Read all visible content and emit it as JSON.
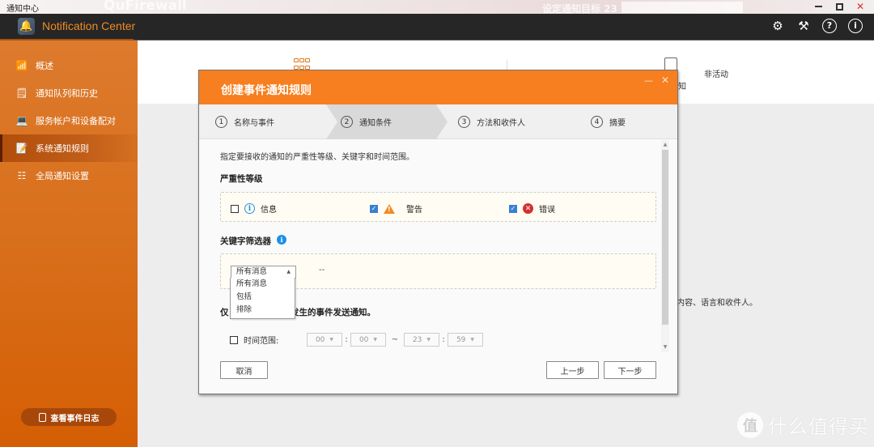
{
  "os_window": {
    "title": "通知中心",
    "background_app_text": "QuFirewall",
    "background_text_2": "设定通知目标 23"
  },
  "app": {
    "name": "Notification Center",
    "header_icons": [
      "gear-icon",
      "magic-wand-icon",
      "help-icon",
      "info-icon"
    ]
  },
  "sidebar": {
    "items": [
      {
        "label": "概述",
        "icon": "chart-icon",
        "active": false
      },
      {
        "label": "通知队列和历史",
        "icon": "history-doc-icon",
        "active": false
      },
      {
        "label": "服务帐户和设备配对",
        "icon": "device-pair-icon",
        "active": false
      },
      {
        "label": "系统通知规则",
        "icon": "rule-edit-icon",
        "active": true
      },
      {
        "label": "全局通知设置",
        "icon": "toggle-settings-icon",
        "active": false
      }
    ],
    "event_log_button": "查看事件日志"
  },
  "background": {
    "inactive_label": "非活动",
    "notify_fragment": "知",
    "desc_fragment": "内容、语言和收件人。"
  },
  "dialog": {
    "title": "创建事件通知规则",
    "steps": [
      {
        "num": "1",
        "label": "名称与事件"
      },
      {
        "num": "2",
        "label": "通知条件",
        "active": true
      },
      {
        "num": "3",
        "label": "方法和收件人"
      },
      {
        "num": "4",
        "label": "摘要"
      }
    ],
    "description": "指定要接收的通知的严重性等级、关键字和时间范围。",
    "severity": {
      "title": "严重性等级",
      "items": [
        {
          "label": "信息",
          "checked": false,
          "icon": "info-icon"
        },
        {
          "label": "警告",
          "checked": true,
          "icon": "warning-icon"
        },
        {
          "label": "错误",
          "checked": true,
          "icon": "error-icon"
        }
      ]
    },
    "keyword": {
      "title": "关键字筛选器",
      "selected": "所有消息",
      "placeholder_dash": "--",
      "options": [
        "所有消息",
        "包括",
        "排除"
      ]
    },
    "time": {
      "line_prefix": "仅",
      "line_suffix": "内发生的事件发送通知。",
      "checkbox_label": "时间范围:",
      "checked": false,
      "start_hour": "00",
      "start_minute": "00",
      "end_hour": "23",
      "end_minute": "59",
      "range_sep": "~",
      "colon": ":"
    },
    "buttons": {
      "cancel": "取消",
      "prev": "上一步",
      "next": "下一步"
    }
  },
  "watermark": {
    "glyph": "值",
    "text": "什么值得买"
  },
  "colors": {
    "accent": "#f77f1f",
    "sidebar": "#d86f1b",
    "header_bg": "#262626",
    "checkbox_blue": "#3a7fd6"
  }
}
